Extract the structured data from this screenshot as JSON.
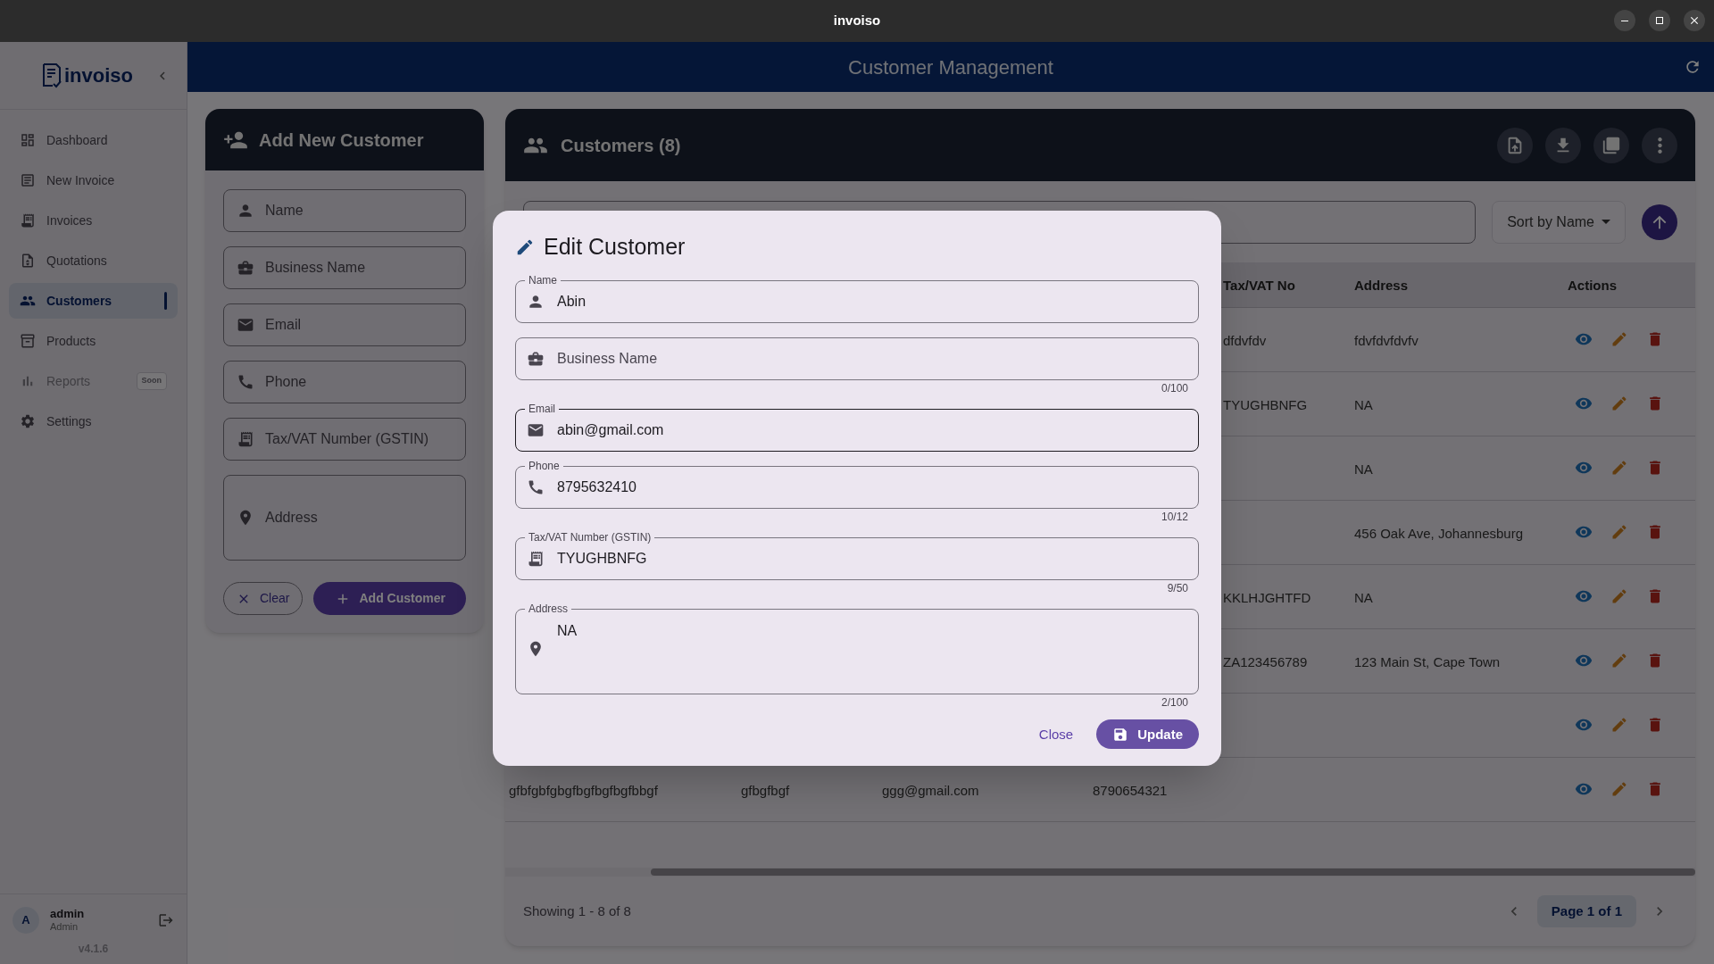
{
  "window": {
    "title": "invoiso"
  },
  "sidebar": {
    "logo": "invoiso",
    "items": [
      {
        "label": "Dashboard",
        "selected": false,
        "disabled": false
      },
      {
        "label": "New Invoice",
        "selected": false,
        "disabled": false
      },
      {
        "label": "Invoices",
        "selected": false,
        "disabled": false
      },
      {
        "label": "Quotations",
        "selected": false,
        "disabled": false
      },
      {
        "label": "Customers",
        "selected": true,
        "disabled": false
      },
      {
        "label": "Products",
        "selected": false,
        "disabled": false
      },
      {
        "label": "Reports",
        "selected": false,
        "disabled": true,
        "badge": "Soon"
      },
      {
        "label": "Settings",
        "selected": false,
        "disabled": false
      }
    ],
    "user": {
      "avatar": "A",
      "name": "admin",
      "role": "Admin"
    },
    "version": "v4.1.6"
  },
  "header": {
    "title": "Customer Management"
  },
  "add_customer": {
    "title": "Add New Customer",
    "fields": [
      {
        "kind": "input",
        "placeholder": "Name"
      },
      {
        "kind": "input",
        "placeholder": "Business Name"
      },
      {
        "kind": "input",
        "placeholder": "Email"
      },
      {
        "kind": "input",
        "placeholder": "Phone"
      },
      {
        "kind": "input",
        "placeholder": "Tax/VAT Number (GSTIN)"
      },
      {
        "kind": "textarea",
        "placeholder": "Address"
      }
    ],
    "buttons": [
      "Clear",
      "Add Customer"
    ]
  },
  "customers": {
    "title": "Customers (8)",
    "sort": "Sort by Name",
    "columns": [
      "Tax/VAT No",
      "Address",
      "Actions"
    ],
    "rows": [
      {
        "tax": "dfdvfdv",
        "address": "fdvfdvfdvfv"
      },
      {
        "tax": "TYUGHBNFG",
        "address": "NA"
      },
      {
        "address": "NA"
      },
      {
        "address": "456 Oak Ave, Johannesburg"
      },
      {
        "tax": "KKLHJGHTFD",
        "address": "NA"
      },
      {
        "tax": "ZA123456789",
        "address": "123 Main St, Cape Town"
      },
      {},
      {
        "name": "gfbfgbfgbgfbgfbgfbgfbbgf",
        "business": "gfbgfbgf",
        "email": "ggg@gmail.com",
        "phone": "8790654321"
      }
    ],
    "footer": "Showing 1 - 8 of 8",
    "page": "Page 1 of 1"
  },
  "dialog": {
    "title": "Edit Customer",
    "fields": [
      {
        "kind": "input",
        "label": "Name",
        "value": "Abin",
        "focused": false
      },
      {
        "kind": "input",
        "placeholder": "Business Name",
        "counter": "0/100",
        "focused": false
      },
      {
        "kind": "input",
        "label": "Email",
        "value": "abin@gmail.com",
        "focused": true
      },
      {
        "kind": "input",
        "label": "Phone",
        "value": "8795632410",
        "counter": "10/12",
        "focused": false
      },
      {
        "kind": "input",
        "label": "Tax/VAT Number (GSTIN)",
        "value": "TYUGHBNFG",
        "counter": "9/50",
        "focused": false
      },
      {
        "kind": "textarea",
        "label": "Address",
        "value": "NA",
        "counter": "2/100",
        "focused": false
      }
    ],
    "buttons": [
      "Close",
      "Update"
    ]
  }
}
